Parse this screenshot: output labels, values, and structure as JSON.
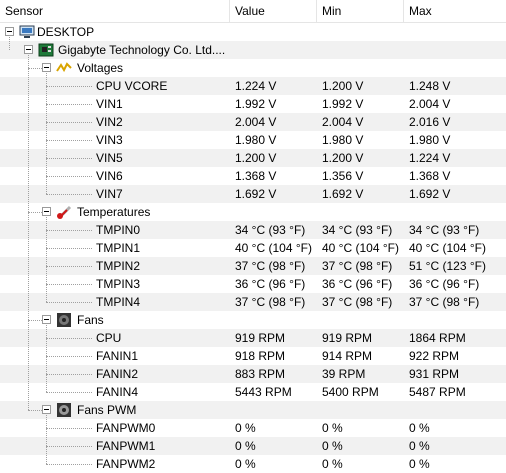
{
  "columns": {
    "sensor": "Sensor",
    "value": "Value",
    "min": "Min",
    "max": "Max"
  },
  "root": {
    "label": "DESKTOP",
    "icon": "computer-icon"
  },
  "board": {
    "label": "Gigabyte Technology Co. Ltd....",
    "icon": "motherboard-icon"
  },
  "groups": [
    {
      "name": "Voltages",
      "icon": "voltage-icon",
      "rows": [
        {
          "label": "CPU VCORE",
          "value": "1.224 V",
          "min": "1.200 V",
          "max": "1.248 V"
        },
        {
          "label": "VIN1",
          "value": "1.992 V",
          "min": "1.992 V",
          "max": "2.004 V"
        },
        {
          "label": "VIN2",
          "value": "2.004 V",
          "min": "2.004 V",
          "max": "2.016 V"
        },
        {
          "label": "VIN3",
          "value": "1.980 V",
          "min": "1.980 V",
          "max": "1.980 V"
        },
        {
          "label": "VIN5",
          "value": "1.200 V",
          "min": "1.200 V",
          "max": "1.224 V"
        },
        {
          "label": "VIN6",
          "value": "1.368 V",
          "min": "1.356 V",
          "max": "1.368 V"
        },
        {
          "label": "VIN7",
          "value": "1.692 V",
          "min": "1.692 V",
          "max": "1.692 V"
        }
      ]
    },
    {
      "name": "Temperatures",
      "icon": "thermometer-icon",
      "rows": [
        {
          "label": "TMPIN0",
          "value": "34 °C  (93 °F)",
          "min": "34 °C  (93 °F)",
          "max": "34 °C  (93 °F)"
        },
        {
          "label": "TMPIN1",
          "value": "40 °C  (104 °F)",
          "min": "40 °C  (104 °F)",
          "max": "40 °C  (104 °F)"
        },
        {
          "label": "TMPIN2",
          "value": "37 °C  (98 °F)",
          "min": "37 °C  (98 °F)",
          "max": "51 °C  (123 °F)"
        },
        {
          "label": "TMPIN3",
          "value": "36 °C  (96 °F)",
          "min": "36 °C  (96 °F)",
          "max": "36 °C  (96 °F)"
        },
        {
          "label": "TMPIN4",
          "value": "37 °C  (98 °F)",
          "min": "37 °C  (98 °F)",
          "max": "37 °C  (98 °F)"
        }
      ]
    },
    {
      "name": "Fans",
      "icon": "fan-icon",
      "rows": [
        {
          "label": "CPU",
          "value": "919 RPM",
          "min": "919 RPM",
          "max": "1864 RPM"
        },
        {
          "label": "FANIN1",
          "value": "918 RPM",
          "min": "914 RPM",
          "max": "922 RPM"
        },
        {
          "label": "FANIN2",
          "value": "883 RPM",
          "min": "39 RPM",
          "max": "931 RPM"
        },
        {
          "label": "FANIN4",
          "value": "5443 RPM",
          "min": "5400 RPM",
          "max": "5487 RPM"
        }
      ]
    },
    {
      "name": "Fans PWM",
      "icon": "fan-pwm-icon",
      "rows": [
        {
          "label": "FANPWM0",
          "value": "0 %",
          "min": "0 %",
          "max": "0 %"
        },
        {
          "label": "FANPWM1",
          "value": "0 %",
          "min": "0 %",
          "max": "0 %"
        },
        {
          "label": "FANPWM2",
          "value": "0 %",
          "min": "0 %",
          "max": "0 %"
        }
      ]
    }
  ]
}
